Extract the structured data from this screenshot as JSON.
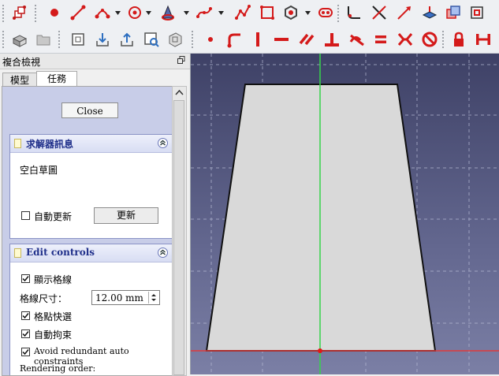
{
  "panel": {
    "title": "複合檢視",
    "tabs": [
      {
        "label": "模型"
      },
      {
        "label": "任務"
      }
    ],
    "close_label": "Close"
  },
  "solver": {
    "title": "求解器訊息",
    "status": "空白草圖",
    "auto_update_label": "自動更新",
    "auto_update_checked": false,
    "update_label": "更新"
  },
  "edit_controls": {
    "title": "Edit controls",
    "show_grid_label": "顯示格線",
    "grid_size_label": "格線尺寸：",
    "grid_size_value": "12.00 mm",
    "grid_snap_label": "格點快選",
    "auto_constraints_label": "自動拘束",
    "avoid_redundant_label": "Avoid redundant auto constraints",
    "rendering_order_label": "Rendering order:",
    "show_grid_checked": true,
    "grid_snap_checked": true,
    "auto_constraints_checked": true,
    "avoid_redundant_checked": true
  },
  "toolbar_top": [
    {
      "name": "sketch-view-icon"
    },
    {
      "name": "point-icon"
    },
    {
      "name": "line-icon"
    },
    {
      "name": "arc-icon"
    },
    {
      "name": "circle-icon"
    },
    {
      "name": "conic-icon"
    },
    {
      "name": "bspline-icon"
    },
    {
      "name": "polyline-icon"
    },
    {
      "name": "rectangle-icon"
    },
    {
      "name": "polygon-icon"
    },
    {
      "name": "slot-icon"
    },
    {
      "name": "fillet-icon"
    },
    {
      "name": "trim-icon"
    },
    {
      "name": "extend-icon"
    },
    {
      "name": "external-geometry-icon"
    },
    {
      "name": "carbon-copy-icon"
    },
    {
      "name": "construction-mode-icon"
    }
  ],
  "toolbar_bottom": [
    {
      "name": "new-sketch-icon"
    },
    {
      "name": "open-folder-icon"
    },
    {
      "name": "validate-sketch-icon"
    },
    {
      "name": "import-icon"
    },
    {
      "name": "export-icon"
    },
    {
      "name": "view-section-icon"
    },
    {
      "name": "map-sketch-icon"
    },
    {
      "name": "coincident-constraint-icon"
    },
    {
      "name": "point-on-object-constraint-icon"
    },
    {
      "name": "vertical-constraint-icon"
    },
    {
      "name": "horizontal-constraint-icon"
    },
    {
      "name": "parallel-constraint-icon"
    },
    {
      "name": "perpendicular-constraint-icon"
    },
    {
      "name": "tangent-constraint-icon"
    },
    {
      "name": "equal-constraint-icon"
    },
    {
      "name": "symmetric-constraint-icon"
    },
    {
      "name": "block-constraint-icon"
    },
    {
      "name": "lock-constraint-icon"
    },
    {
      "name": "horizontal-distance-constraint-icon"
    }
  ],
  "colors": {
    "constraint_red": "#d41a1a",
    "sketch_face": "#d9d9d9",
    "axis_green": "#35d44a",
    "axis_red": "#e03a3a",
    "canvas_top": "#3e4166",
    "canvas_bottom": "#7b7fa5"
  }
}
